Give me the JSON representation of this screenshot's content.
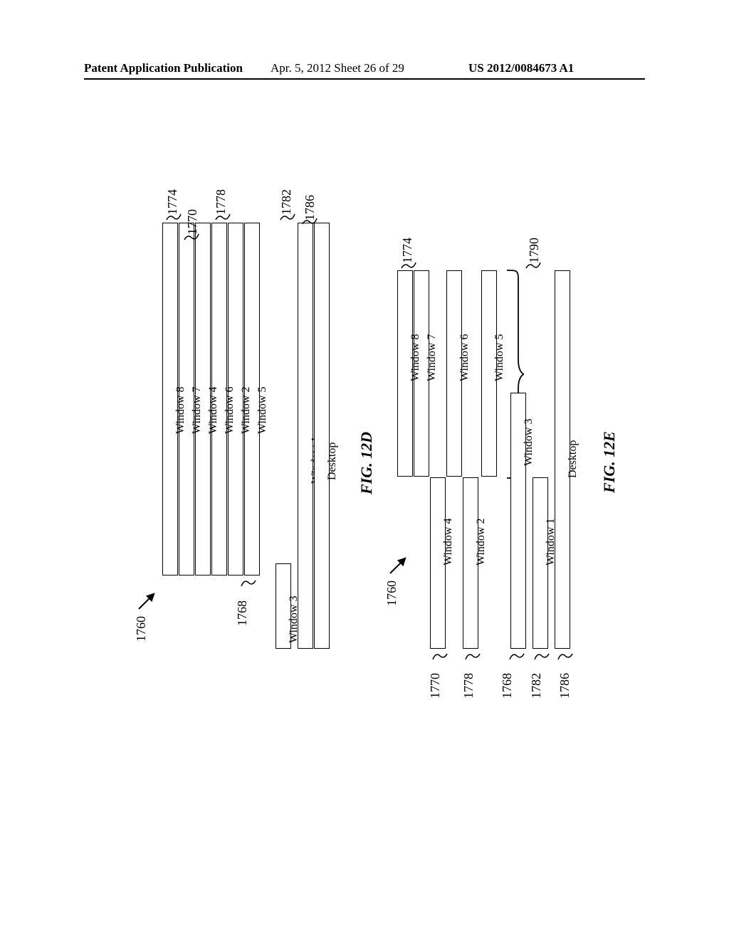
{
  "header": {
    "left": "Patent Application Publication",
    "center": "Apr. 5, 2012  Sheet 26 of 29",
    "right": "US 2012/0084673 A1"
  },
  "fig12D": {
    "caption": "FIG. 12D",
    "stackTopRef": "1760",
    "bars": [
      {
        "label": "Window 8",
        "ref": "1774"
      },
      {
        "label": "Window 7",
        "ref": "1770"
      },
      {
        "label": "Window 4",
        "ref": ""
      },
      {
        "label": "Window 6",
        "ref": "1778"
      },
      {
        "label": "Window 2",
        "ref": ""
      },
      {
        "label": "Window 5",
        "ref": ""
      }
    ],
    "extraRefAtBar6": "1768",
    "window3": {
      "label": "Window 3",
      "ref": "1782"
    },
    "window1": {
      "label": "Window 1",
      "ref": "1786"
    },
    "desktop": {
      "label": "Desktop"
    }
  },
  "fig12E": {
    "caption": "FIG. 12E",
    "stackTopRef": "1760",
    "rightGroupRefTop": "1774",
    "rightGroupRefBrace": "1790",
    "rightBars": [
      {
        "label": "Window 8"
      },
      {
        "label": "Window 7"
      },
      {
        "label": "Window 6"
      },
      {
        "label": "Window 5"
      }
    ],
    "leftBars": [
      {
        "label": "Window 4",
        "ref": "1770"
      },
      {
        "label": "Window 2",
        "ref": "1778"
      }
    ],
    "window3": {
      "label": "Window 3",
      "ref": "1768"
    },
    "window1": {
      "label": "Window 1",
      "ref": "1782"
    },
    "desktop": {
      "label": "Desktop",
      "ref": "1786"
    }
  }
}
